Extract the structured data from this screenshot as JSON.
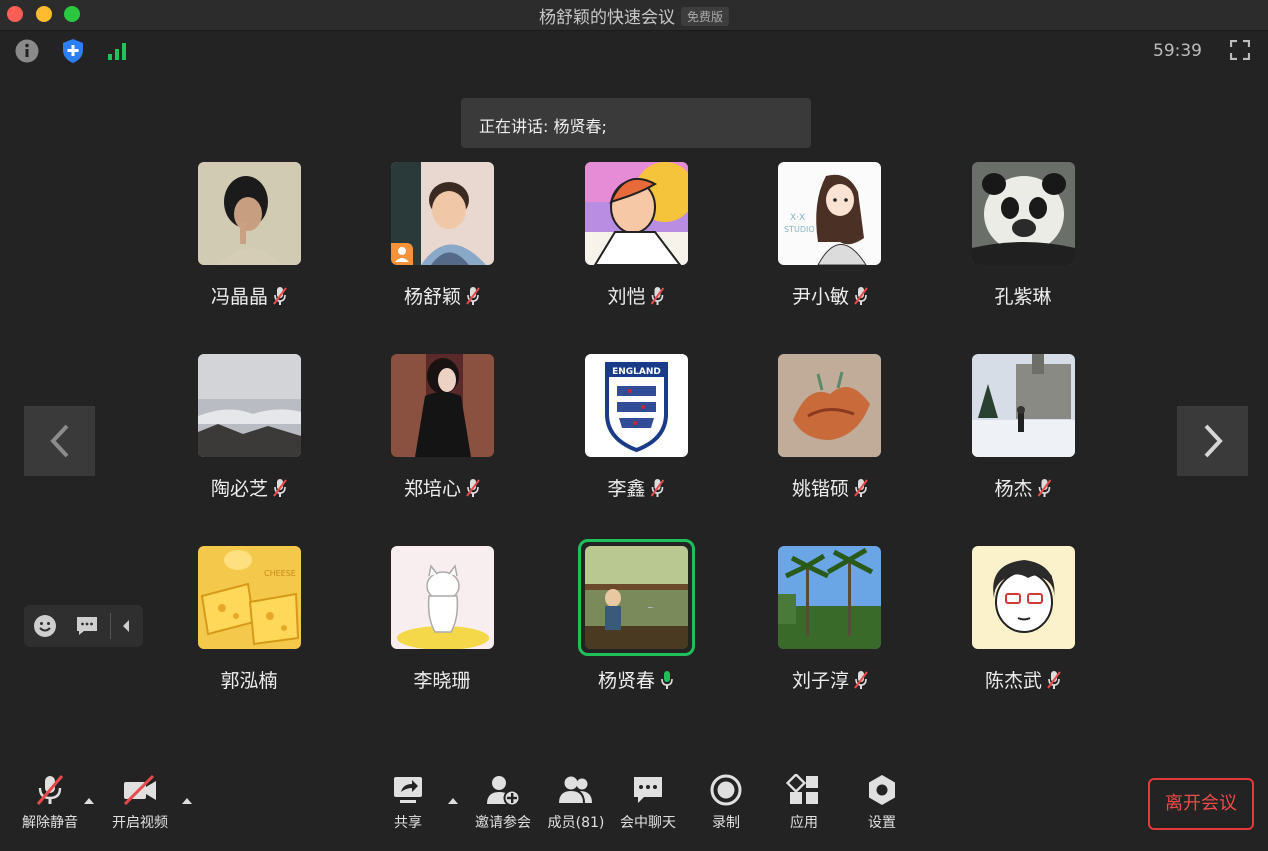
{
  "window": {
    "title": "杨舒颖的快速会议",
    "badge": "免费版",
    "timer": "59:39"
  },
  "speaking": "正在讲话: 杨贤春;",
  "participants": [
    {
      "name": "冯晶晶",
      "mic": "muted"
    },
    {
      "name": "杨舒颖",
      "mic": "muted",
      "host": true
    },
    {
      "name": "刘恺",
      "mic": "muted"
    },
    {
      "name": "尹小敏",
      "mic": "muted"
    },
    {
      "name": "孔紫琳",
      "mic": "none"
    },
    {
      "name": "陶必芝",
      "mic": "muted"
    },
    {
      "name": "郑培心",
      "mic": "muted"
    },
    {
      "name": "李鑫",
      "mic": "muted"
    },
    {
      "name": "姚锴硕",
      "mic": "muted"
    },
    {
      "name": "杨杰",
      "mic": "muted"
    },
    {
      "name": "郭泓楠",
      "mic": "none"
    },
    {
      "name": "李晓珊",
      "mic": "none"
    },
    {
      "name": "杨贤春",
      "mic": "active",
      "speaking": true
    },
    {
      "name": "刘子淳",
      "mic": "muted"
    },
    {
      "name": "陈杰武",
      "mic": "muted"
    }
  ],
  "avatars": {
    "england_text": "ENGLAND",
    "sticker_x": "X·X",
    "sticker_studio": "STUDIO",
    "cheese_text": "CHEESE"
  },
  "toolbar": {
    "unmute": "解除静音",
    "video": "开启视频",
    "share": "共享",
    "invite": "邀请参会",
    "members": "成员(81)",
    "chat": "会中聊天",
    "record": "录制",
    "apps": "应用",
    "settings": "设置",
    "leave": "离开会议"
  },
  "colors": {
    "background": "#232323",
    "active_speaker": "#1fc05a",
    "leave": "#e2383c",
    "shield": "#2c7ff7",
    "signal": "#22c35a"
  },
  "icons": [
    "info-icon",
    "shield-plus-icon",
    "signal-icon",
    "fullscreen-icon",
    "chevron-left-icon",
    "chevron-right-icon",
    "emoji-icon",
    "chat-bubble-icon",
    "caret-left-icon",
    "mic-muted-icon",
    "video-off-icon",
    "share-screen-icon",
    "invite-icon",
    "members-icon",
    "chat-icon",
    "record-icon",
    "apps-icon",
    "settings-icon"
  ]
}
